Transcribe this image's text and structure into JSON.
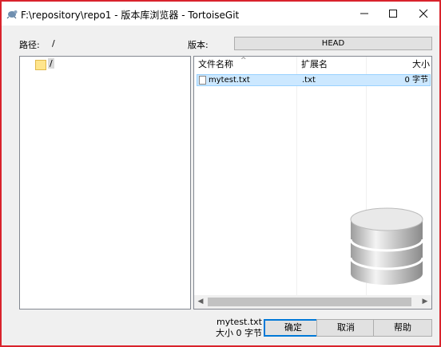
{
  "window": {
    "title": "F:\\repository\\repo1 - 版本库浏览器 - TortoiseGit",
    "minimize_icon": "minimize-icon",
    "maximize_icon": "maximize-icon",
    "close_icon": "close-icon"
  },
  "path": {
    "label": "路径:",
    "value": "/"
  },
  "revision": {
    "label": "版本:",
    "value": "HEAD"
  },
  "tree": {
    "items": [
      {
        "label": "/",
        "icon": "folder-icon"
      }
    ]
  },
  "file_list": {
    "columns": [
      "文件名称",
      "扩展名",
      "大小"
    ],
    "rows": [
      {
        "name": "mytest.txt",
        "ext": ".txt",
        "size": "0 字节",
        "icon": "file-icon"
      }
    ]
  },
  "status": {
    "filename": "mytest.txt",
    "size": "大小 0 字节"
  },
  "buttons": {
    "ok": "确定",
    "cancel": "取消",
    "help": "帮助"
  },
  "colors": {
    "accent": "#0078d7",
    "highlight_border": "#d9232c",
    "selection": "#cce8ff"
  }
}
